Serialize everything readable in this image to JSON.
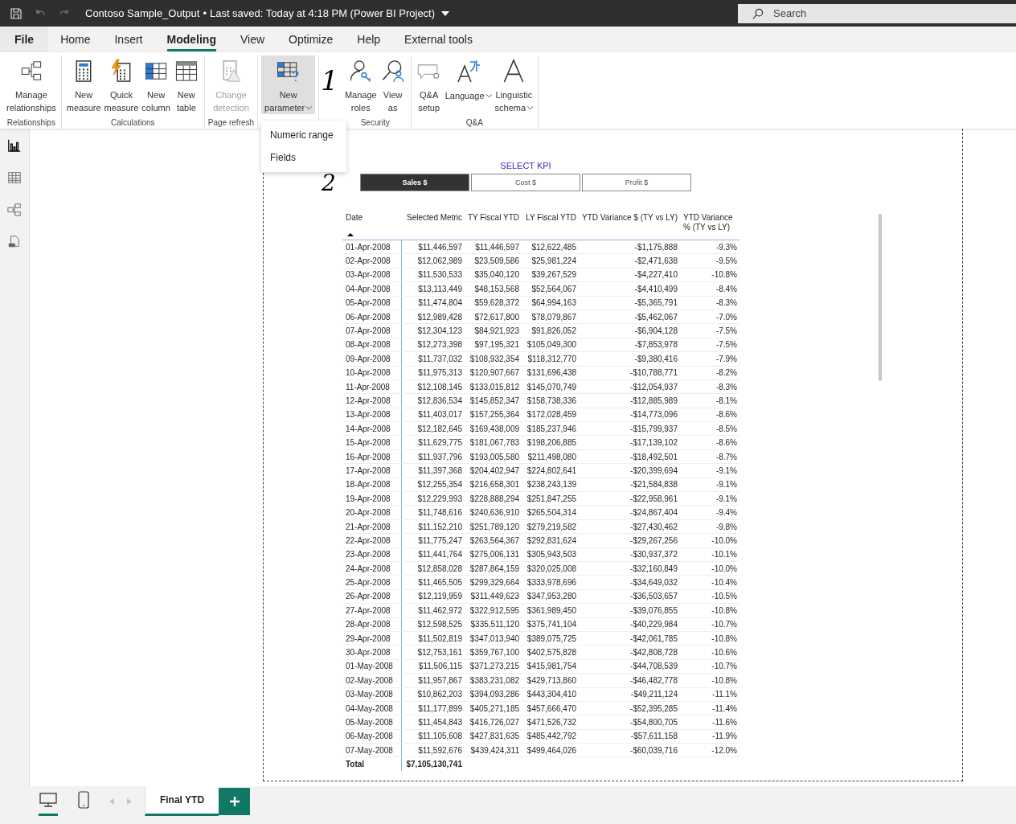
{
  "title_bar": {
    "title": "Contoso Sample_Output",
    "separator": "•",
    "saved": "Last saved: Today at 4:18 PM (Power BI Project)",
    "search": {
      "placeholder": "Search"
    },
    "redo_disabled": true
  },
  "menu_tabs": [
    {
      "label": "File",
      "selected": false,
      "kind": "file"
    },
    {
      "label": "Home",
      "selected": false,
      "kind": "tab"
    },
    {
      "label": "Insert",
      "selected": false,
      "kind": "tab"
    },
    {
      "label": "Modeling",
      "selected": true,
      "kind": "tab"
    },
    {
      "label": "View",
      "selected": false,
      "kind": "tab"
    },
    {
      "label": "Optimize",
      "selected": false,
      "kind": "tab"
    },
    {
      "label": "Help",
      "selected": false,
      "kind": "tab"
    },
    {
      "label": "External tools",
      "selected": false,
      "kind": "tab"
    }
  ],
  "ribbon_groups": [
    {
      "label": "Relationships",
      "buttons": [
        {
          "lines": [
            "Manage",
            "relationships"
          ],
          "disabled": false,
          "dropdown": false,
          "pressed": false
        }
      ]
    },
    {
      "label": "Calculations",
      "buttons": [
        {
          "lines": [
            "New",
            "measure"
          ],
          "disabled": false,
          "dropdown": false,
          "pressed": false
        },
        {
          "lines": [
            "Quick",
            "measure"
          ],
          "disabled": false,
          "dropdown": false,
          "pressed": false
        },
        {
          "lines": [
            "New",
            "column"
          ],
          "disabled": false,
          "dropdown": false,
          "pressed": false
        },
        {
          "lines": [
            "New",
            "table"
          ],
          "disabled": false,
          "dropdown": false,
          "pressed": false
        }
      ]
    },
    {
      "label": "Page refresh",
      "buttons": [
        {
          "lines": [
            "Change",
            "detection"
          ],
          "disabled": true,
          "dropdown": false,
          "pressed": false
        }
      ]
    },
    {
      "buttons": [
        {
          "lines": [
            "New",
            "parameter"
          ],
          "disabled": false,
          "dropdown": true,
          "pressed": true
        }
      ]
    },
    {
      "label": "Security",
      "buttons": [
        {
          "lines": [
            "Manage",
            "roles"
          ],
          "disabled": false,
          "dropdown": false,
          "pressed": false
        },
        {
          "lines": [
            "View",
            "as"
          ],
          "disabled": false,
          "dropdown": false,
          "pressed": false
        }
      ]
    },
    {
      "label": "Q&A",
      "buttons": [
        {
          "lines": [
            "Q&A",
            "setup"
          ],
          "disabled": false,
          "dropdown": false,
          "pressed": false
        },
        {
          "lines": [
            "Language"
          ],
          "disabled": false,
          "dropdown": true,
          "pressed": false
        },
        {
          "lines": [
            "Linguistic",
            "schema"
          ],
          "disabled": false,
          "dropdown": true,
          "pressed": false
        }
      ]
    }
  ],
  "dropdown_menu": [
    "Numeric range",
    "Fields"
  ],
  "annotations": [
    "1",
    "2"
  ],
  "left_rail": [
    {
      "selected": true
    },
    {
      "selected": false
    },
    {
      "selected": false
    },
    {
      "selected": false
    }
  ],
  "kpi_slicer": {
    "title": "SELECT KPI",
    "options": [
      {
        "label": "Sales $",
        "selected": true
      },
      {
        "label": "Cost $",
        "selected": false
      },
      {
        "label": "Profit $",
        "selected": false
      }
    ]
  },
  "table": {
    "columns": [
      "Date",
      "Selected Metric",
      "TY Fiscal YTD",
      "LY Fiscal YTD",
      "YTD Variance $ (TY vs LY)",
      "YTD Variance % (TY vs LY)"
    ],
    "rows": [
      [
        "01-Apr-2008",
        "$11,446,597",
        "$11,446,597",
        "$12,622,485",
        "-$1,175,888",
        "-9.3%"
      ],
      [
        "02-Apr-2008",
        "$12,062,989",
        "$23,509,586",
        "$25,981,224",
        "-$2,471,638",
        "-9.5%"
      ],
      [
        "03-Apr-2008",
        "$11,530,533",
        "$35,040,120",
        "$39,267,529",
        "-$4,227,410",
        "-10.8%"
      ],
      [
        "04-Apr-2008",
        "$13,113,449",
        "$48,153,568",
        "$52,564,067",
        "-$4,410,499",
        "-8.4%"
      ],
      [
        "05-Apr-2008",
        "$11,474,804",
        "$59,628,372",
        "$64,994,163",
        "-$5,365,791",
        "-8.3%"
      ],
      [
        "06-Apr-2008",
        "$12,989,428",
        "$72,617,800",
        "$78,079,867",
        "-$5,462,067",
        "-7.0%"
      ],
      [
        "07-Apr-2008",
        "$12,304,123",
        "$84,921,923",
        "$91,826,052",
        "-$6,904,128",
        "-7.5%"
      ],
      [
        "08-Apr-2008",
        "$12,273,398",
        "$97,195,321",
        "$105,049,300",
        "-$7,853,978",
        "-7.5%"
      ],
      [
        "09-Apr-2008",
        "$11,737,032",
        "$108,932,354",
        "$118,312,770",
        "-$9,380,416",
        "-7.9%"
      ],
      [
        "10-Apr-2008",
        "$11,975,313",
        "$120,907,667",
        "$131,696,438",
        "-$10,788,771",
        "-8.2%"
      ],
      [
        "11-Apr-2008",
        "$12,108,145",
        "$133,015,812",
        "$145,070,749",
        "-$12,054,937",
        "-8.3%"
      ],
      [
        "12-Apr-2008",
        "$12,836,534",
        "$145,852,347",
        "$158,738,336",
        "-$12,885,989",
        "-8.1%"
      ],
      [
        "13-Apr-2008",
        "$11,403,017",
        "$157,255,364",
        "$172,028,459",
        "-$14,773,096",
        "-8.6%"
      ],
      [
        "14-Apr-2008",
        "$12,182,645",
        "$169,438,009",
        "$185,237,946",
        "-$15,799,937",
        "-8.5%"
      ],
      [
        "15-Apr-2008",
        "$11,629,775",
        "$181,067,783",
        "$198,206,885",
        "-$17,139,102",
        "-8.6%"
      ],
      [
        "16-Apr-2008",
        "$11,937,796",
        "$193,005,580",
        "$211,498,080",
        "-$18,492,501",
        "-8.7%"
      ],
      [
        "17-Apr-2008",
        "$11,397,368",
        "$204,402,947",
        "$224,802,641",
        "-$20,399,694",
        "-9.1%"
      ],
      [
        "18-Apr-2008",
        "$12,255,354",
        "$216,658,301",
        "$238,243,139",
        "-$21,584,838",
        "-9.1%"
      ],
      [
        "19-Apr-2008",
        "$12,229,993",
        "$228,888,294",
        "$251,847,255",
        "-$22,958,961",
        "-9.1%"
      ],
      [
        "20-Apr-2008",
        "$11,748,616",
        "$240,636,910",
        "$265,504,314",
        "-$24,867,404",
        "-9.4%"
      ],
      [
        "21-Apr-2008",
        "$11,152,210",
        "$251,789,120",
        "$279,219,582",
        "-$27,430,462",
        "-9.8%"
      ],
      [
        "22-Apr-2008",
        "$11,775,247",
        "$263,564,367",
        "$292,831,624",
        "-$29,267,256",
        "-10.0%"
      ],
      [
        "23-Apr-2008",
        "$11,441,764",
        "$275,006,131",
        "$305,943,503",
        "-$30,937,372",
        "-10.1%"
      ],
      [
        "24-Apr-2008",
        "$12,858,028",
        "$287,864,159",
        "$320,025,008",
        "-$32,160,849",
        "-10.0%"
      ],
      [
        "25-Apr-2008",
        "$11,465,505",
        "$299,329,664",
        "$333,978,696",
        "-$34,649,032",
        "-10.4%"
      ],
      [
        "26-Apr-2008",
        "$12,119,959",
        "$311,449,623",
        "$347,953,280",
        "-$36,503,657",
        "-10.5%"
      ],
      [
        "27-Apr-2008",
        "$11,462,972",
        "$322,912,595",
        "$361,989,450",
        "-$39,076,855",
        "-10.8%"
      ],
      [
        "28-Apr-2008",
        "$12,598,525",
        "$335,511,120",
        "$375,741,104",
        "-$40,229,984",
        "-10.7%"
      ],
      [
        "29-Apr-2008",
        "$11,502,819",
        "$347,013,940",
        "$389,075,725",
        "-$42,061,785",
        "-10.8%"
      ],
      [
        "30-Apr-2008",
        "$12,753,161",
        "$359,767,100",
        "$402,575,828",
        "-$42,808,728",
        "-10.6%"
      ],
      [
        "01-May-2008",
        "$11,506,115",
        "$371,273,215",
        "$415,981,754",
        "-$44,708,539",
        "-10.7%"
      ],
      [
        "02-May-2008",
        "$11,957,867",
        "$383,231,082",
        "$429,713,860",
        "-$46,482,778",
        "-10.8%"
      ],
      [
        "03-May-2008",
        "$10,862,203",
        "$394,093,286",
        "$443,304,410",
        "-$49,211,124",
        "-11.1%"
      ],
      [
        "04-May-2008",
        "$11,177,899",
        "$405,271,185",
        "$457,666,470",
        "-$52,395,285",
        "-11.4%"
      ],
      [
        "05-May-2008",
        "$11,454,843",
        "$416,726,027",
        "$471,526,732",
        "-$54,800,705",
        "-11.6%"
      ],
      [
        "06-May-2008",
        "$11,105,608",
        "$427,831,635",
        "$485,442,792",
        "-$57,611,158",
        "-11.9%"
      ],
      [
        "07-May-2008",
        "$11,592,676",
        "$439,424,311",
        "$499,464,026",
        "-$60,039,716",
        "-12.0%"
      ]
    ],
    "total": [
      "Total",
      "$7,105,130,741"
    ]
  },
  "page_tabs": [
    {
      "label": "Final YTD",
      "selected": true
    }
  ],
  "view_buttons": [
    {
      "selected": true
    },
    {
      "selected": false
    }
  ]
}
